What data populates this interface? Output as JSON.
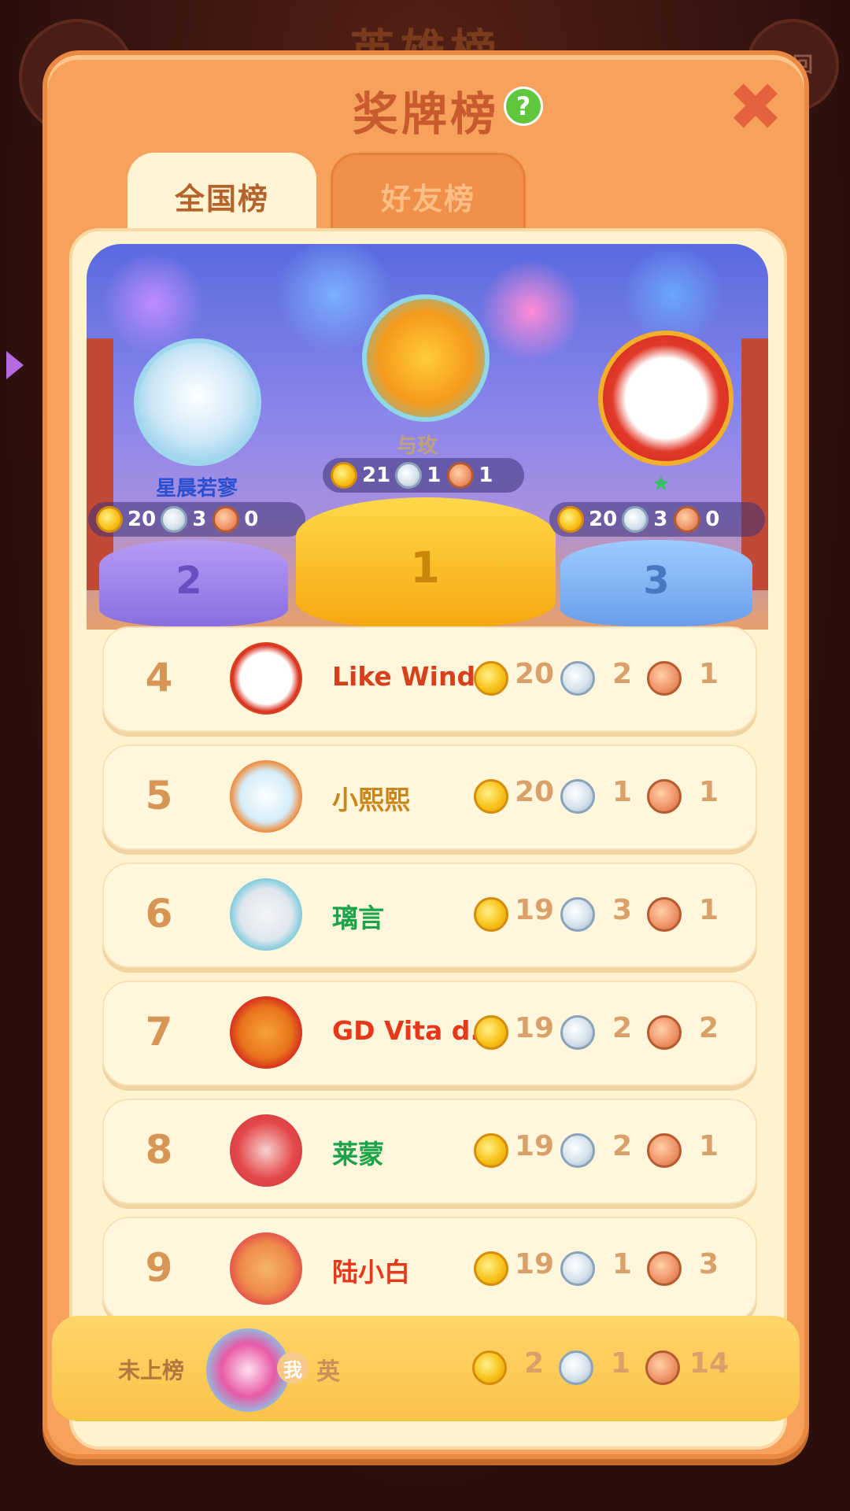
{
  "background": {
    "title": "英雄榜",
    "back_label": "返回"
  },
  "dialog": {
    "title": "奖牌榜",
    "help_symbol": "?",
    "close_symbol": "✖"
  },
  "tabs": [
    {
      "label": "全国榜",
      "active": true
    },
    {
      "label": "好友榜",
      "active": false
    }
  ],
  "podium": {
    "first": {
      "name": "与玫",
      "gold": "21",
      "silver": "1",
      "bronze": "1",
      "stand": "1"
    },
    "second": {
      "name": "星晨若寥",
      "gold": "20",
      "silver": "3",
      "bronze": "0",
      "stand": "2"
    },
    "third": {
      "name": "★",
      "gold": "20",
      "silver": "3",
      "bronze": "0",
      "stand": "3"
    }
  },
  "rows": [
    {
      "rank": "4",
      "name": "Like  Wind",
      "name_color": "#d8401c",
      "gold": "20",
      "silver": "2",
      "bronze": "1"
    },
    {
      "rank": "5",
      "name": "小熙熙",
      "name_color": "#c8861a",
      "gold": "20",
      "silver": "1",
      "bronze": "1"
    },
    {
      "rank": "6",
      "name": "璃言",
      "name_color": "#1aa34a",
      "gold": "19",
      "silver": "3",
      "bronze": "1"
    },
    {
      "rank": "7",
      "name": "GD Vita d...",
      "name_color": "#e8381c",
      "gold": "19",
      "silver": "2",
      "bronze": "2"
    },
    {
      "rank": "8",
      "name": "莱蒙",
      "name_color": "#1aa34a",
      "gold": "19",
      "silver": "2",
      "bronze": "1"
    },
    {
      "rank": "9",
      "name": "陆小白",
      "name_color": "#e8381c",
      "gold": "19",
      "silver": "1",
      "bronze": "3"
    }
  ],
  "me": {
    "rank_label": "未上榜",
    "tag": "我",
    "name": "英",
    "gold": "2",
    "silver": "1",
    "bronze": "14"
  },
  "colors": {
    "accent": "#f6a15c",
    "gold": "#f8c21a",
    "silver": "#d6e2ec",
    "bronze": "#f0966a"
  }
}
